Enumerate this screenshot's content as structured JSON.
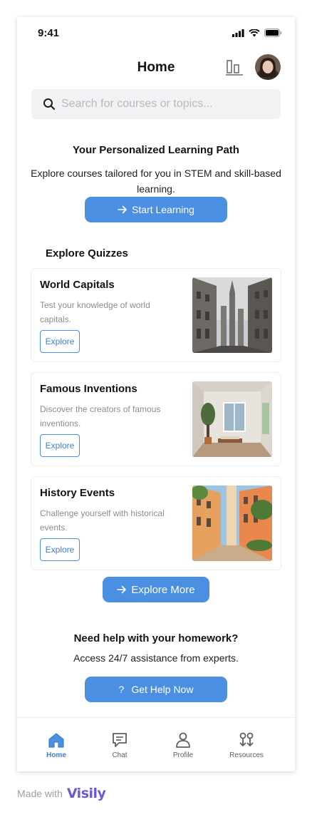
{
  "status_bar": {
    "time": "9:41"
  },
  "header": {
    "title": "Home"
  },
  "search": {
    "placeholder": "Search for courses or topics..."
  },
  "hero": {
    "title": "Your Personalized Learning Path",
    "description": "Explore courses tailored for you in STEM and skill-based learning.",
    "button_label": "Start Learning",
    "button_icon": "arrow-right-icon"
  },
  "quizzes": {
    "section_title": "Explore Quizzes",
    "items": [
      {
        "title": "World Capitals",
        "description": "Test your knowledge of world capitals.",
        "button_label": "Explore"
      },
      {
        "title": "Famous Inventions",
        "description": "Discover the creators of famous inventions.",
        "button_label": "Explore"
      },
      {
        "title": "History Events",
        "description": "Challenge yourself with historical events.",
        "button_label": "Explore"
      }
    ],
    "more_label": "Explore More"
  },
  "help": {
    "title": "Need help with your homework?",
    "description": "Access 24/7 assistance from experts.",
    "button_label": "Get Help Now",
    "button_icon_glyph": "?"
  },
  "tabbar": {
    "items": [
      {
        "label": "Home",
        "icon": "home-icon",
        "active": true
      },
      {
        "label": "Chat",
        "icon": "chat-icon",
        "active": false
      },
      {
        "label": "Profile",
        "icon": "person-icon",
        "active": false
      },
      {
        "label": "Resources",
        "icon": "resources-icon",
        "active": false
      }
    ]
  },
  "footer": {
    "made_with": "Made with",
    "brand": "Visily"
  },
  "colors": {
    "accent": "#4a8fe2",
    "text": "#141414",
    "muted": "#8a8d92",
    "search_bg": "#f1f2f4"
  }
}
